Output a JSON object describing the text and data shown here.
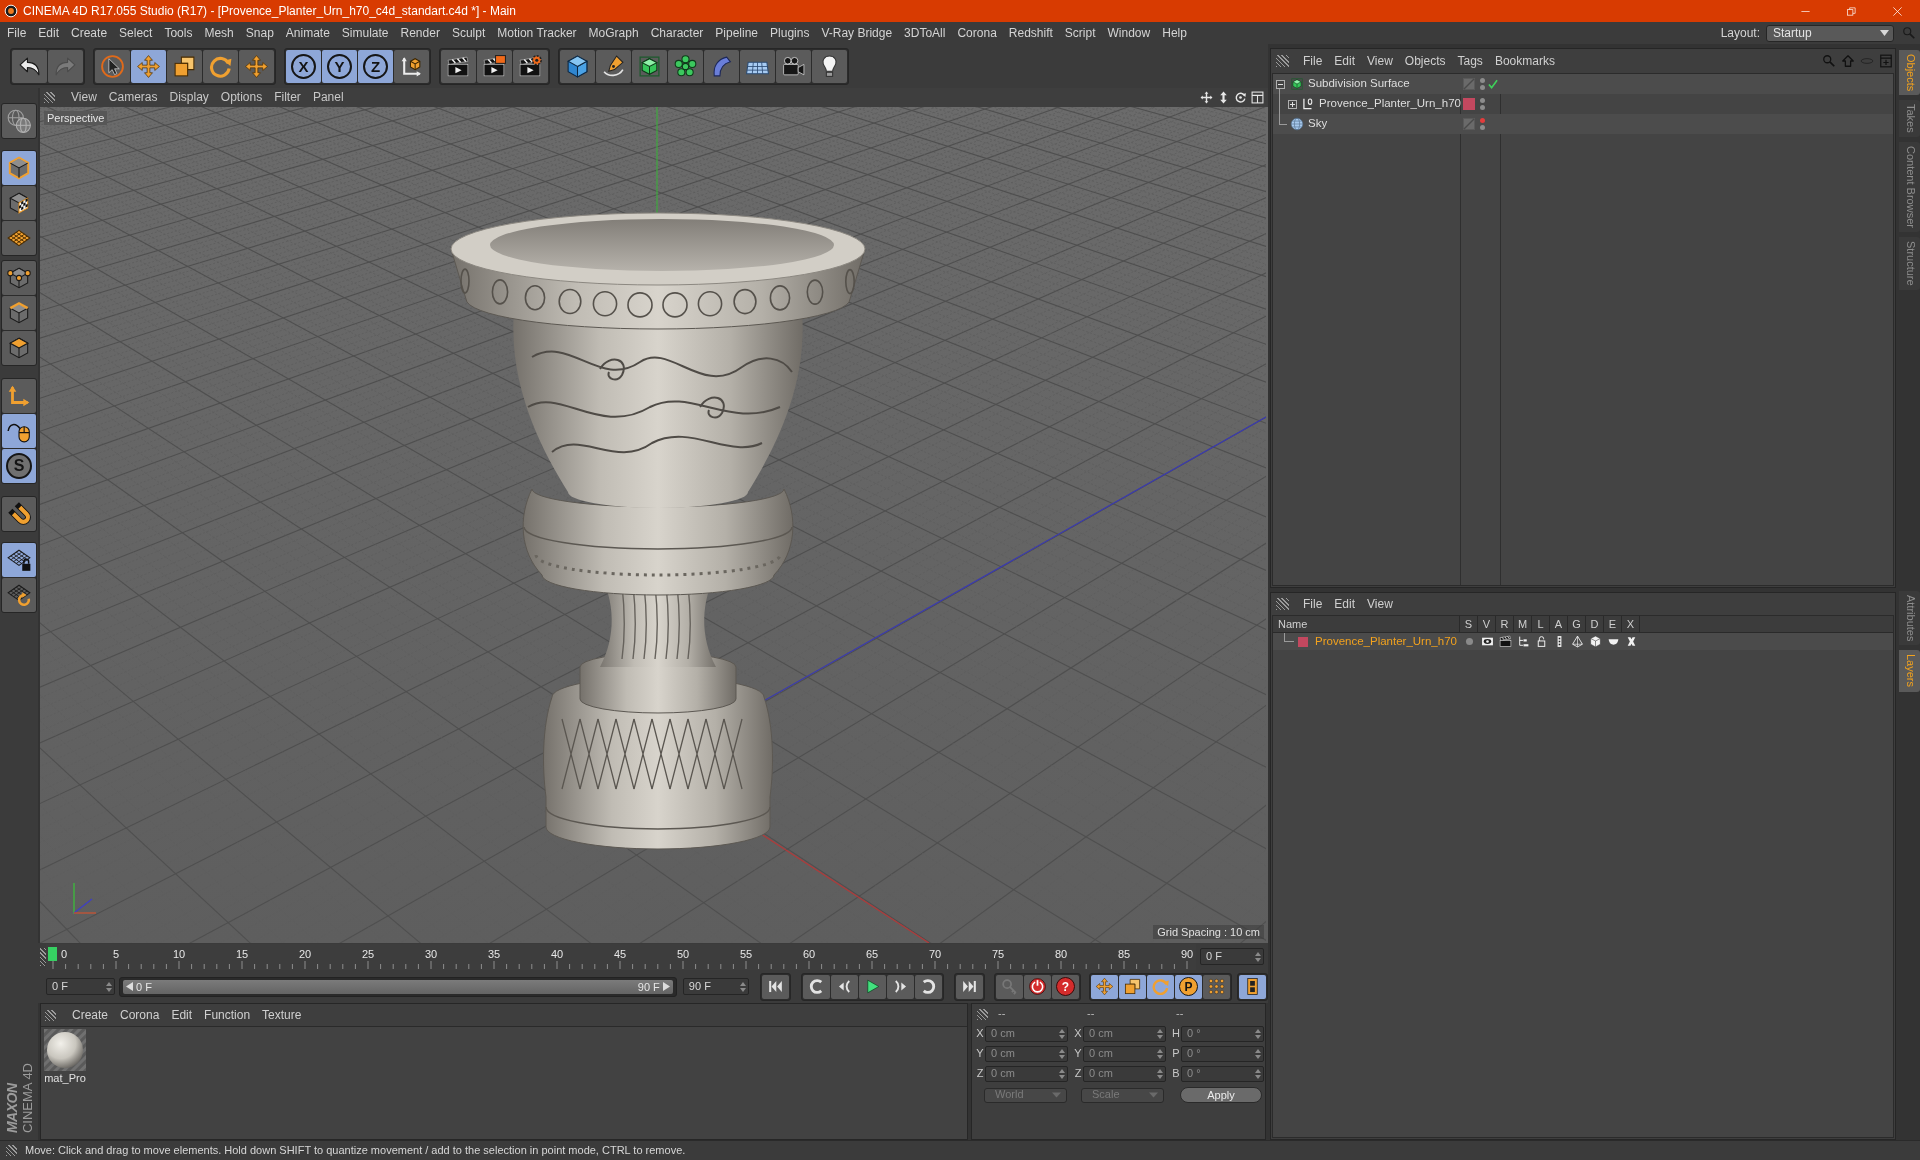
{
  "window": {
    "title": "CINEMA 4D R17.055 Studio (R17) - [Provence_Planter_Urn_h70_c4d_standart.c4d *] - Main"
  },
  "menu_bar": {
    "items": [
      "File",
      "Edit",
      "Create",
      "Select",
      "Tools",
      "Mesh",
      "Snap",
      "Animate",
      "Simulate",
      "Render",
      "Sculpt",
      "Motion Tracker",
      "MoGraph",
      "Character",
      "Pipeline",
      "Plugins",
      "V-Ray Bridge",
      "3DToAll",
      "Corona",
      "Redshift",
      "Script",
      "Window",
      "Help"
    ],
    "layout_label": "Layout:",
    "layout_value": "Startup"
  },
  "toolbar": [
    [
      {
        "kind": "undo",
        "disabled": false
      },
      {
        "kind": "redo",
        "disabled": true
      }
    ],
    [
      {
        "kind": "select",
        "active": false
      },
      {
        "kind": "move",
        "active": true
      },
      {
        "kind": "scale",
        "active": false
      },
      {
        "kind": "rotate",
        "active": false
      },
      {
        "kind": "recent",
        "active": false
      }
    ],
    [
      {
        "kind": "axis",
        "label": "X",
        "active": true
      },
      {
        "kind": "axis",
        "label": "Y",
        "active": true
      },
      {
        "kind": "axis",
        "label": "Z",
        "active": true
      },
      {
        "kind": "coords",
        "active": false
      }
    ],
    [
      {
        "kind": "renderview"
      },
      {
        "kind": "renderpicture"
      },
      {
        "kind": "rendersettings"
      }
    ],
    [
      {
        "kind": "cube"
      },
      {
        "kind": "pen"
      },
      {
        "kind": "subdivision"
      },
      {
        "kind": "cloner"
      },
      {
        "kind": "bend"
      },
      {
        "kind": "floor"
      },
      {
        "kind": "camera"
      },
      {
        "kind": "light"
      }
    ]
  ],
  "tool_palette": [
    [
      {
        "kind": "navigate",
        "active": false
      }
    ],
    [
      {
        "kind": "model",
        "active": true
      },
      {
        "kind": "texture",
        "active": false
      },
      {
        "kind": "workplane",
        "active": false
      }
    ],
    [
      {
        "kind": "points",
        "active": false
      },
      {
        "kind": "edges",
        "active": false
      },
      {
        "kind": "polygons",
        "active": false
      }
    ],
    [
      {
        "kind": "axismode",
        "active": false
      },
      {
        "kind": "tweak",
        "active": true
      },
      {
        "kind": "solo",
        "label": "S",
        "active": true
      }
    ],
    [
      {
        "kind": "snap",
        "active": false
      }
    ],
    [
      {
        "kind": "gridlock",
        "active": true
      },
      {
        "kind": "gridrotate",
        "active": false
      }
    ]
  ],
  "branding": {
    "company": "MAXON",
    "product": "CINEMA 4D"
  },
  "viewport": {
    "menu": [
      "View",
      "Cameras",
      "Display",
      "Options",
      "Filter",
      "Panel"
    ],
    "camera": "Perspective",
    "grid_spacing": "Grid Spacing : 10 cm"
  },
  "timeline": {
    "ticks": [
      "0",
      "5",
      "10",
      "15",
      "20",
      "25",
      "30",
      "35",
      "40",
      "45",
      "50",
      "55",
      "60",
      "65",
      "70",
      "75",
      "80",
      "85",
      "90"
    ],
    "playhead": {
      "level": 0
    },
    "current_frame": "0 F"
  },
  "transport": {
    "start": "0 F",
    "range": {
      "level": 1,
      "start": "0 F",
      "end": "90 F"
    },
    "end": "90 F",
    "buttons": [
      [
        {
          "kind": "first"
        }
      ],
      [
        {
          "kind": "prevkey"
        },
        {
          "kind": "prevframe"
        },
        {
          "kind": "play"
        },
        {
          "kind": "nextframe"
        },
        {
          "kind": "nextkey"
        }
      ],
      [
        {
          "kind": "last"
        }
      ],
      [
        {
          "kind": "motionpath",
          "disabled": true
        },
        {
          "kind": "record",
          "disabled": false
        },
        {
          "kind": "autokey",
          "label": "?",
          "disabled": false
        }
      ],
      [
        {
          "kind": "keypos",
          "active": true
        },
        {
          "kind": "keyscale",
          "active": true
        },
        {
          "kind": "keyrot",
          "active": true
        },
        {
          "kind": "keyparam",
          "label": "P",
          "active": true
        },
        {
          "kind": "keypla",
          "active": false
        }
      ],
      [
        {
          "kind": "timelinewin",
          "active": true
        }
      ]
    ]
  },
  "materials": {
    "menu": [
      "Create",
      "Corona",
      "Edit",
      "Function",
      "Texture"
    ],
    "items": [
      {
        "name": "mat_Pro"
      }
    ]
  },
  "coordinates": {
    "headers": [
      "--",
      "--",
      "--"
    ],
    "columns": [
      [
        {
          "axis": "X",
          "value": "0 cm"
        },
        {
          "axis": "Y",
          "value": "0 cm"
        },
        {
          "axis": "Z",
          "value": "0 cm"
        }
      ],
      [
        {
          "axis": "X",
          "value": "0 cm"
        },
        {
          "axis": "Y",
          "value": "0 cm"
        },
        {
          "axis": "Z",
          "value": "0 cm"
        }
      ],
      [
        {
          "axis": "H",
          "value": "0 °"
        },
        {
          "axis": "P",
          "value": "0 °"
        },
        {
          "axis": "B",
          "value": "0 °"
        }
      ]
    ],
    "dropdowns": [
      {
        "value": "World",
        "disabled": true
      },
      {
        "value": "Scale",
        "disabled": true
      }
    ],
    "apply": "Apply"
  },
  "status_bar": "Move: Click and drag to move elements. Hold down SHIFT to quantize movement / add to the selection in point mode, CTRL to remove.",
  "object_manager": {
    "menu": [
      "File",
      "Edit",
      "View",
      "Objects",
      "Tags",
      "Bookmarks"
    ],
    "objects": [
      {
        "name": "Subdivision Surface",
        "kind": "subdivision",
        "expanded": true,
        "editor_hidden": false,
        "checked": true,
        "children": [
          {
            "name": "Provence_Planter_Urn_h70",
            "kind": "null",
            "expanded": false,
            "color": "#c3485f",
            "editor_hidden": false,
            "checked": false
          }
        ]
      },
      {
        "name": "Sky",
        "kind": "sky",
        "editor_hidden": true,
        "checked": false
      }
    ]
  },
  "layer_manager": {
    "menu": [
      "File",
      "Edit",
      "View"
    ],
    "columns": [
      "Name",
      "S",
      "V",
      "R",
      "M",
      "L",
      "A",
      "G",
      "D",
      "E",
      "X"
    ],
    "layers": [
      {
        "name": "Provence_Planter_Urn_h70",
        "color": "#c3485f",
        "selected": true,
        "flags": [
          {
            "kind": "solo",
            "on": false
          },
          {
            "kind": "view",
            "on": true
          },
          {
            "kind": "render",
            "on": true
          },
          {
            "kind": "manager",
            "on": true
          },
          {
            "kind": "locked",
            "on": false
          },
          {
            "kind": "animation",
            "on": true
          },
          {
            "kind": "generators",
            "on": true
          },
          {
            "kind": "deformers",
            "on": true
          },
          {
            "kind": "expressions",
            "on": true
          },
          {
            "kind": "xrefs",
            "on": true
          }
        ]
      }
    ]
  },
  "side_tabs": {
    "upper": [
      {
        "label": "Objects",
        "selected": true
      },
      {
        "label": "Takes",
        "selected": false
      },
      {
        "label": "Content Browser",
        "selected": false
      },
      {
        "label": "Structure",
        "selected": false
      }
    ],
    "lower": [
      {
        "label": "Attributes",
        "selected": false
      },
      {
        "label": "Layers",
        "selected": true
      }
    ]
  }
}
